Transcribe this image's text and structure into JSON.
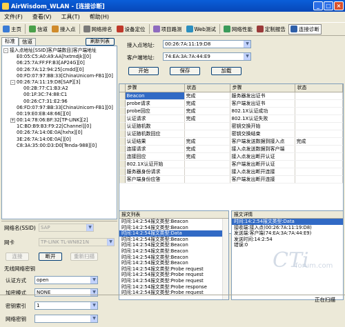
{
  "window": {
    "title": "AirWisdom_WLAN - [连接诊断]"
  },
  "menu": [
    "文件(F)",
    "查看(V)",
    "工具(T)",
    "帮助(H)"
  ],
  "toolbar": [
    {
      "label": "主页",
      "icon": "home-icon",
      "color": "#3a7bd5"
    },
    {
      "label": "信道",
      "icon": "antenna-icon",
      "color": "#4aa04a"
    },
    {
      "label": "接入点",
      "icon": "access-point-icon",
      "color": "#d08b2b"
    },
    {
      "label": "网络排名",
      "icon": "ranking-icon",
      "color": "#7a7a7a"
    },
    {
      "label": "设备定位",
      "icon": "locate-icon",
      "color": "#c0392b"
    },
    {
      "label": "项目路测",
      "icon": "survey-icon",
      "color": "#8e6bbf"
    },
    {
      "label": "Web测试",
      "icon": "web-icon",
      "color": "#2c8fbf"
    },
    {
      "label": "网络性能",
      "icon": "performance-icon",
      "color": "#3a9b5a"
    },
    {
      "label": "定制报告",
      "icon": "report-icon",
      "color": "#9b3a3a"
    },
    {
      "label": "连接诊断",
      "icon": "diagnose-icon",
      "color": "#2f5fa8"
    }
  ],
  "left": {
    "tabs": [
      "标准",
      "信道"
    ],
    "refresh_label": "刷新列表",
    "tree": [
      {
        "indent": 0,
        "pm": "-",
        "text": "接入点地址[SSID]客户端数目]客户端地址"
      },
      {
        "indent": 1,
        "pm": "",
        "text": "E0:05:C5:A0:A9:AA[hxtmdjk][0]"
      },
      {
        "indent": 1,
        "pm": "",
        "text": "06:25:7A:FF:FF:B3[AP24G][0]"
      },
      {
        "indent": 1,
        "pm": "",
        "text": "00:26:7A:12:94:25[cmdd][0]"
      },
      {
        "indent": 1,
        "pm": "",
        "text": "00:FD:07:97:BB:33[ChinaUnicom-FB1][0]"
      },
      {
        "indent": 1,
        "pm": "-",
        "text": "00:26:7A:11:19:D8[SAP][3]"
      },
      {
        "indent": 2,
        "pm": "",
        "text": "00:2B:77:C1:B3:A2"
      },
      {
        "indent": 2,
        "pm": "",
        "text": "00:1F:3C:74:88:C1"
      },
      {
        "indent": 2,
        "pm": "",
        "text": "00:26:C7:31:E2:96"
      },
      {
        "indent": 1,
        "pm": "",
        "text": "06:FD:07:97:BB:33[ChinaUnicom-FB1][0]"
      },
      {
        "indent": 1,
        "pm": "",
        "text": "00:19:E0:EB:48:66[][0]"
      },
      {
        "indent": 1,
        "pm": "+",
        "text": "00:14:78:06:BF:32[TP-LINK][2]"
      },
      {
        "indent": 1,
        "pm": "",
        "text": "1C:BD:B9:B3:F9:22[Channel][0]"
      },
      {
        "indent": 1,
        "pm": "",
        "text": "00:26:7A:14:0E:0A[hxhx][0]"
      },
      {
        "indent": 1,
        "pm": "",
        "text": "3E:26:7A:14:0E:0A[][0]"
      },
      {
        "indent": 1,
        "pm": "",
        "text": "C8:3A:35:00:D3:D0[Tenda-988][0]"
      }
    ],
    "ssid_label": "网络名(SSID)",
    "ssid_value": "SAP",
    "nic_label": "网卡",
    "nic_value": "TP-LINK TL-WN821N",
    "connect_label": "连接",
    "disconnect_label": "断开",
    "rescan_label": "重新扫描",
    "security": {
      "title": "无线网络密钥",
      "auth_label": "认证方式",
      "auth_value": "open",
      "enc_label": "加密模式",
      "enc_value": "NONE",
      "keyidx_label": "密钥索引",
      "keyidx_value": "1",
      "key_label": "网络密钥",
      "key_value": ""
    }
  },
  "right": {
    "ap_label": "接入点地址:",
    "ap_value": "00:26:7A:11:19:D8",
    "client_label": "客户端地址:",
    "client_value": "74:EA:3A:7A:44:E9",
    "start_label": "开始",
    "save_label": "保存",
    "load_label": "加载",
    "headers": [
      "步骤",
      "状态",
      "步骤",
      "状态"
    ],
    "rows": [
      [
        "Beacon",
        "完成",
        "服务器发出证书",
        ""
      ],
      [
        "probe请求",
        "完成",
        "客户端发出证书",
        ""
      ],
      [
        "probe回应",
        "完成",
        "802.1X认证成功",
        ""
      ],
      [
        "认证请求",
        "完成",
        "802.1X认证失败",
        ""
      ],
      [
        "认证随机数",
        "",
        "密钥交换开始",
        ""
      ],
      [
        "认证随机数回应",
        "",
        "密钥交换结束",
        ""
      ],
      [
        "认证结果",
        "完成",
        "客户端发送数据到接入点",
        "完成"
      ],
      [
        "连接请求",
        "完成",
        "接入点发送数据到客户端",
        ""
      ],
      [
        "连接回应",
        "完成",
        "接入点发出断开认证",
        ""
      ],
      [
        "802.1X认证开始",
        "",
        "客户端发出断开认证",
        ""
      ],
      [
        "服务器身份请求",
        "",
        "接入点发出断开连接",
        ""
      ],
      [
        "客户端身份应答",
        "",
        "客户端发出断开连接",
        ""
      ]
    ],
    "packet_list": {
      "title": "报文列表",
      "items": [
        "时间:14:2:54报文类型:Beacon",
        "时间:14:2:54报文类型:Beacon",
        "时间:14:2:54报文类型:Data",
        "时间:14:2:54报文类型:Beacon",
        "时间:14:2:54报文类型:Beacon",
        "时间:14:2:54报文类型:Beacon",
        "时间:14:2:54报文类型:Beacon",
        "时间:14:2:54报文类型:Beacon",
        "时间:14:2:54报文类型:Probe request",
        "时间:14:2:54报文类型:Probe request",
        "时间:14:2:54报文类型:Probe request",
        "时间:14:2:54报文类型:Probe response",
        "时间:14:2:54报文类型:Probe request"
      ],
      "selected": 2
    },
    "packet_detail": {
      "title": "报文详情",
      "lines": [
        "时间:14:2:54报文类型:Data",
        "接收端:接入点(00:26:7A:11:19:D8)",
        "发送端:客户端(74:EA:3A:7A:44:E9)",
        "发送时间:14:2:54",
        "错误:0"
      ]
    }
  },
  "statusbar": {
    "text": "正在扫描"
  },
  "watermark": "CTi",
  "watermark_sub": "forum.com"
}
